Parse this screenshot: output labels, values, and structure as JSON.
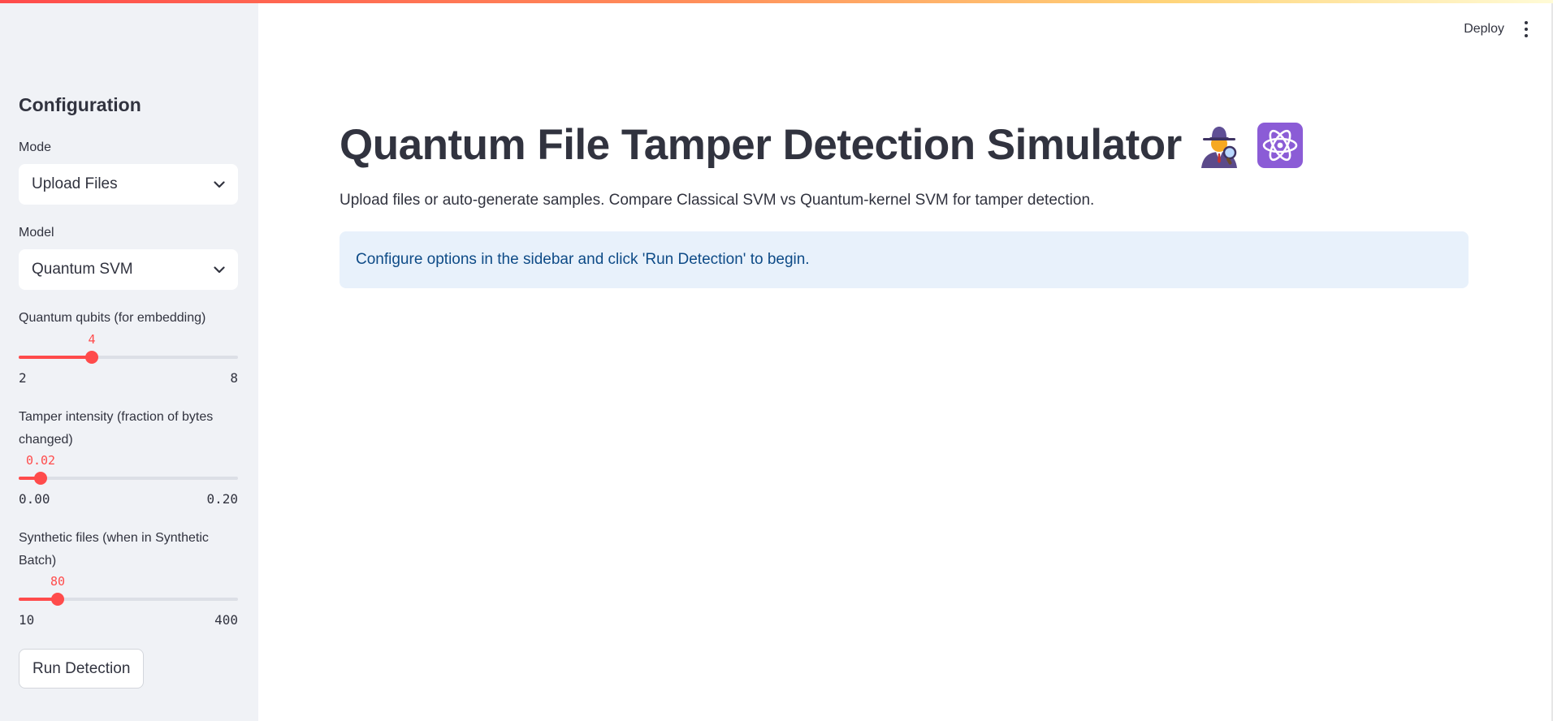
{
  "header": {
    "deploy_label": "Deploy",
    "menu_icon": "kebab-menu-icon"
  },
  "sidebar": {
    "title": "Configuration",
    "mode": {
      "label": "Mode",
      "value": "Upload Files"
    },
    "model": {
      "label": "Model",
      "value": "Quantum SVM"
    },
    "qubits": {
      "label": "Quantum qubits (for embedding)",
      "value": "4",
      "min": "2",
      "max": "8"
    },
    "tamper": {
      "label": "Tamper intensity (fraction of bytes changed)",
      "value": "0.02",
      "min": "0.00",
      "max": "0.20"
    },
    "synthetic": {
      "label": "Synthetic files (when in Synthetic Batch)",
      "value": "80",
      "min": "10",
      "max": "400"
    },
    "run_button": "Run Detection"
  },
  "main": {
    "title": "Quantum File Tamper Detection Simulator",
    "title_icons": [
      "detective-emoji",
      "atom-symbol-emoji"
    ],
    "subtitle": "Upload files or auto-generate samples. Compare Classical SVM vs Quantum-kernel SVM for tamper detection.",
    "info": "Configure options in the sidebar and click 'Run Detection' to begin."
  },
  "colors": {
    "accent": "#ff4b4b",
    "info_bg": "#e8f1fb",
    "info_text": "#0e4b87",
    "sidebar_bg": "#f0f2f6"
  }
}
